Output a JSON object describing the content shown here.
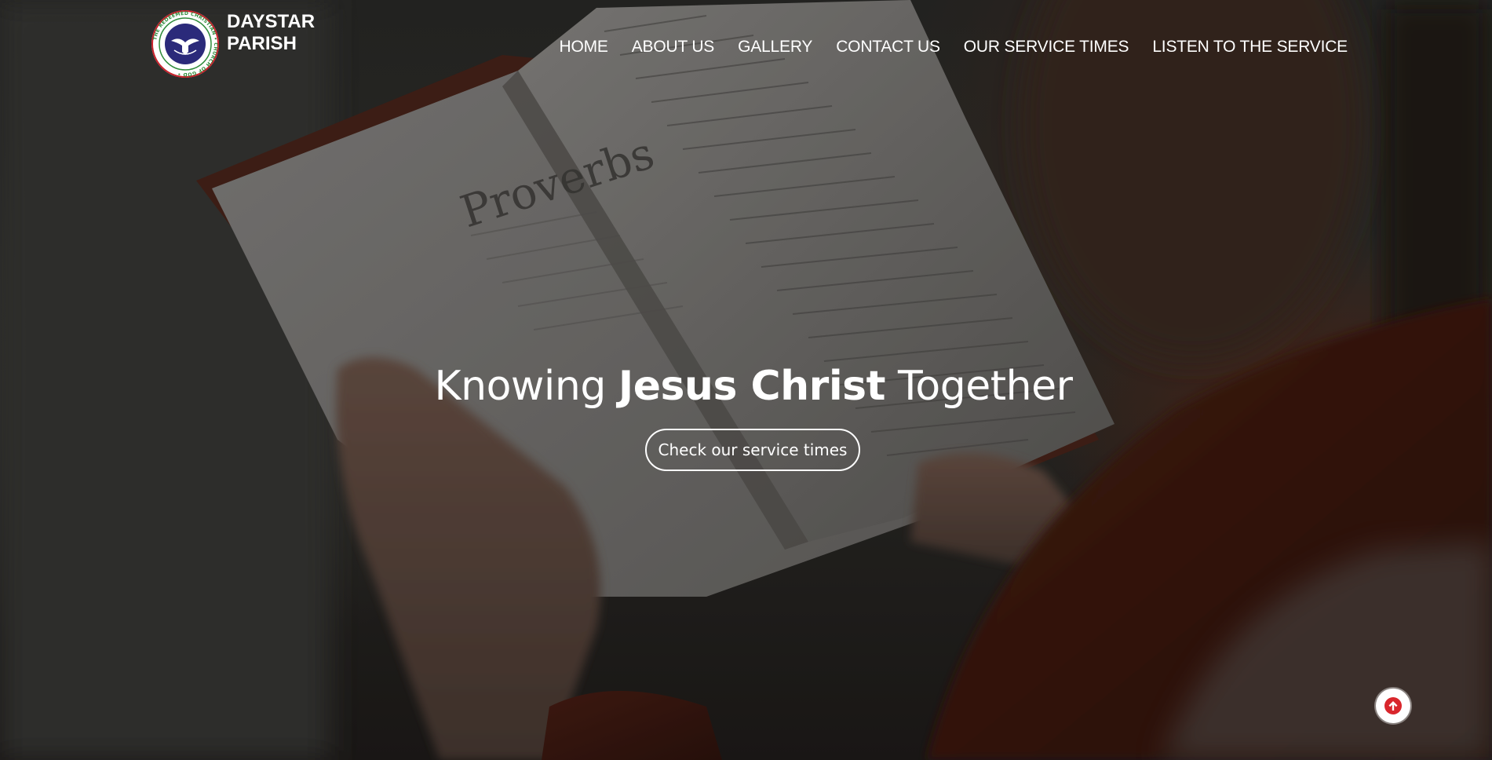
{
  "site": {
    "brand_line1": "DAYSTAR",
    "brand_line2": "PARISH",
    "logo_ring_text": "THE REDEEMED CHRISTIAN CHURCH OF GOD"
  },
  "nav": {
    "items": [
      {
        "label": "HOME"
      },
      {
        "label": "ABOUT US"
      },
      {
        "label": "GALLERY"
      },
      {
        "label": "CONTACT US"
      },
      {
        "label": "OUR SERVICE TIMES"
      },
      {
        "label": "LISTEN TO THE SERVICE"
      }
    ]
  },
  "hero": {
    "headline_pre": "Knowing ",
    "headline_strong": "Jesus Christ",
    "headline_post": " Together",
    "cta_label": "Check our service times",
    "book_heading": "Proverbs"
  },
  "icons": {
    "scroll_top": "arrow-up-circle-icon"
  },
  "colors": {
    "logo_blue": "#2b2a7a",
    "logo_green": "#2e8b3a",
    "logo_red": "#c8202a",
    "scroll_top_accent": "#d9262c",
    "text": "#ffffff"
  }
}
